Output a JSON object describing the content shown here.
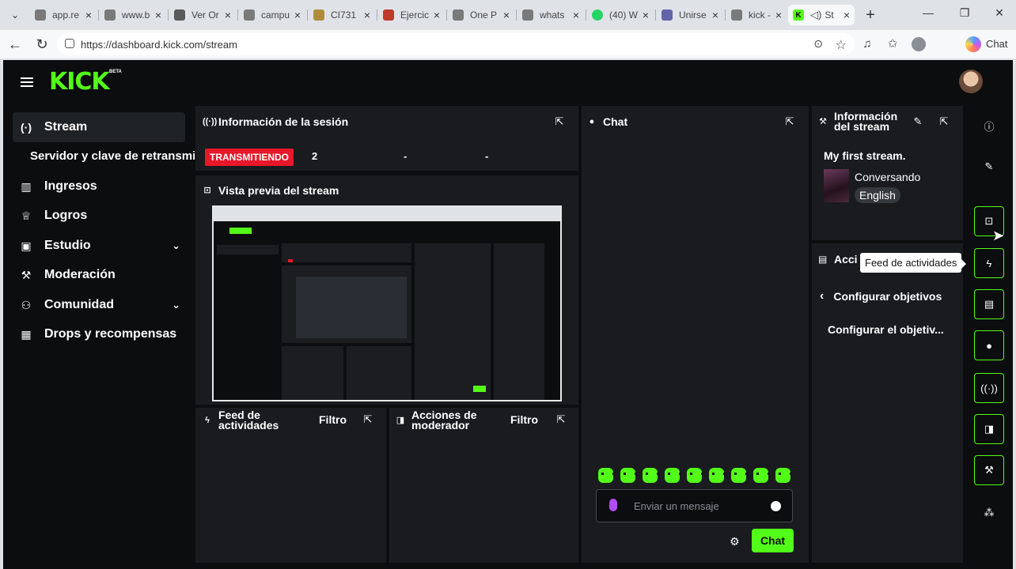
{
  "browser": {
    "tabs": [
      {
        "title": "app.re",
        "color": "#7a7a7a"
      },
      {
        "title": "www.b",
        "color": "#7a7a7a"
      },
      {
        "title": "Ver Or",
        "color": "#5a5a5a"
      },
      {
        "title": "campu",
        "color": "#7a7a7a"
      },
      {
        "title": "CI731",
        "color": "#b08c3a"
      },
      {
        "title": "Ejercic",
        "color": "#c0392b"
      },
      {
        "title": "One P",
        "color": "#7a7a7a"
      },
      {
        "title": "whats",
        "color": "#7a7a7a"
      },
      {
        "title": "(40) W",
        "color": "#25d366"
      },
      {
        "title": "Unirse",
        "color": "#6264a7"
      },
      {
        "title": "kick - I",
        "color": "#7a7a7a"
      },
      {
        "title": "St",
        "color": "#53fc18"
      }
    ],
    "url": "https://dashboard.kick.com/stream",
    "chat_label": "Chat"
  },
  "app": {
    "logo": "KICK",
    "beta": "BETA"
  },
  "sidebar": {
    "items": [
      {
        "label": "Stream",
        "icon": "(·)",
        "active": true
      },
      {
        "label": "Ingresos",
        "icon": "▥"
      },
      {
        "label": "Logros",
        "icon": "♕"
      },
      {
        "label": "Estudio",
        "icon": "▣",
        "chevron": "⌄"
      },
      {
        "label": "Moderación",
        "icon": "⚒"
      },
      {
        "label": "Comunidad",
        "icon": "⚇",
        "chevron": "⌄"
      },
      {
        "label": "Drops y recompensas",
        "icon": "▦"
      }
    ],
    "sub_item": "Servidor y clave de retransmisión"
  },
  "session": {
    "title": "Información de la sesión",
    "status": "TRANSMITIENDO",
    "viewers": "2",
    "stat2": "-",
    "stat3": "-"
  },
  "preview": {
    "title": "Vista previa del stream"
  },
  "feed": {
    "title_l1": "Feed de",
    "title_l2": "actividades",
    "filter": "Filtro"
  },
  "modactions": {
    "title_l1": "Acciones de",
    "title_l2": "moderador",
    "filter": "Filtro"
  },
  "chat": {
    "title": "Chat",
    "placeholder": "Enviar un mensaje",
    "send": "Chat"
  },
  "streaminfo": {
    "title_l1": "Información",
    "title_l2": "del stream",
    "stream_title": "My first stream.",
    "category": "Conversando",
    "language": "English"
  },
  "channel_actions": {
    "title": "Acci",
    "back_label": "Configurar objetivos",
    "goal_label": "Configurar el objetiv..."
  },
  "tooltip": "Feed de actividades",
  "colors": {
    "accent": "#53fc18",
    "live": "#e8172a",
    "panel": "#191b1f",
    "bg": "#0b0d0e"
  }
}
